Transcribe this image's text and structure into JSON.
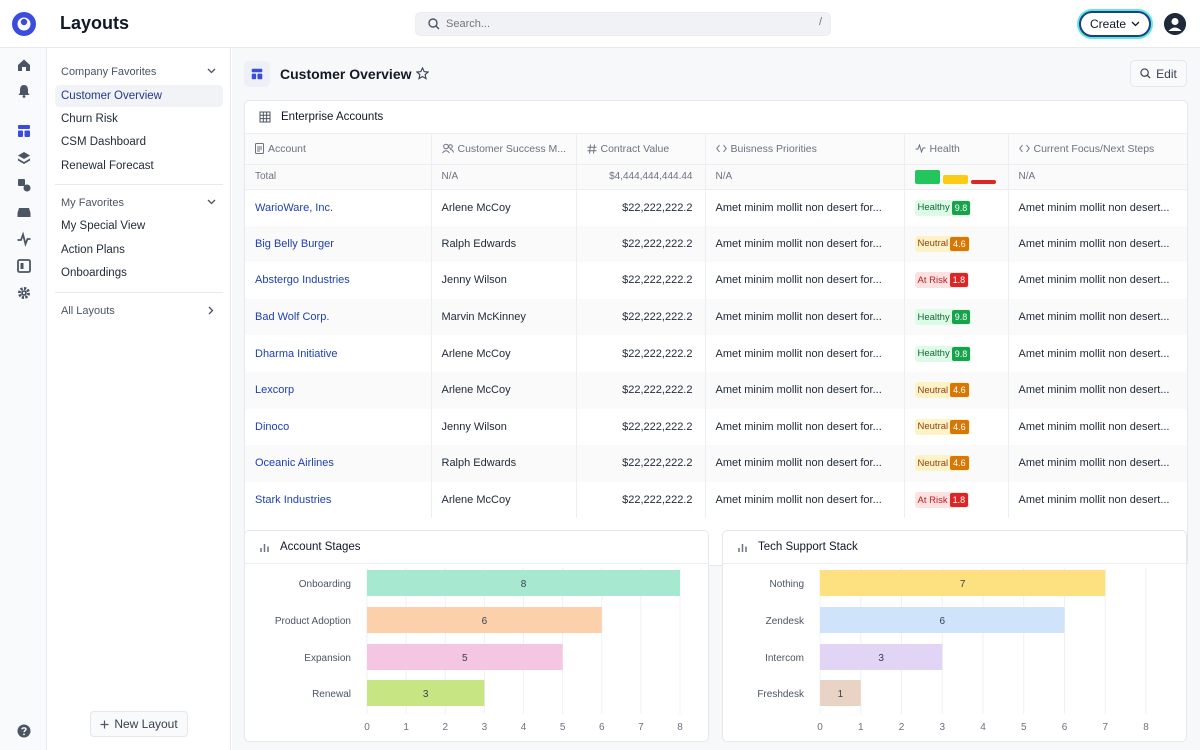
{
  "app_title": "Layouts",
  "search": {
    "placeholder": "Search...",
    "shortcut": "/"
  },
  "create_label": "Create",
  "sidebar": {
    "company_favorites": {
      "title": "Company Favorites",
      "items": [
        "Customer Overview",
        "Churn Risk",
        "CSM Dashboard",
        "Renewal Forecast"
      ],
      "active": "Customer Overview"
    },
    "my_favorites": {
      "title": "My Favorites",
      "items": [
        "My Special View",
        "Action Plans",
        "Onboardings"
      ]
    },
    "all_layouts": "All Layouts",
    "new_layout": "New Layout"
  },
  "rail_icons": [
    "home-icon",
    "bell-icon",
    "layouts-icon",
    "layers-icon",
    "shapes-icon",
    "inbox-icon",
    "activity-icon",
    "panel-icon",
    "gear-icon",
    "help-icon"
  ],
  "page": {
    "title": "Customer Overview",
    "edit_label": "Edit"
  },
  "table_card": {
    "title": "Enterprise Accounts",
    "columns": [
      "Account",
      "Customer Success M...",
      "Contract Value",
      "Buisness Priorities",
      "Health",
      "Current Focus/Next Steps"
    ],
    "total": {
      "label": "Total",
      "csm": "N/A",
      "value": "$4,444,444,444.44",
      "priorities": "N/A",
      "focus": "N/A"
    },
    "rows": [
      {
        "account": "WarioWare, Inc.",
        "csm": "Arlene McCoy",
        "value": "$22,222,222.2",
        "priorities": "Amet minim mollit non desert for...",
        "health": "Healthy",
        "score": "9.8",
        "focus": "Amet minim mollit non desert..."
      },
      {
        "account": "Big Belly Burger",
        "csm": "Ralph Edwards",
        "value": "$22,222,222.2",
        "priorities": "Amet minim mollit non desert for...",
        "health": "Neutral",
        "score": "4.6",
        "focus": "Amet minim mollit non desert..."
      },
      {
        "account": "Abstergo Industries",
        "csm": "Jenny Wilson",
        "value": "$22,222,222.2",
        "priorities": "Amet minim mollit non desert for...",
        "health": "At Risk",
        "score": "1.8",
        "focus": "Amet minim mollit non desert..."
      },
      {
        "account": "Bad Wolf Corp.",
        "csm": "Marvin McKinney",
        "value": "$22,222,222.2",
        "priorities": "Amet minim mollit non desert for...",
        "health": "Healthy",
        "score": "9.8",
        "focus": "Amet minim mollit non desert..."
      },
      {
        "account": "Dharma Initiative",
        "csm": "Arlene McCoy",
        "value": "$22,222,222.2",
        "priorities": "Amet minim mollit non desert for...",
        "health": "Healthy",
        "score": "9.8",
        "focus": "Amet minim mollit non desert..."
      },
      {
        "account": "Lexcorp",
        "csm": "Arlene McCoy",
        "value": "$22,222,222.2",
        "priorities": "Amet minim mollit non desert for...",
        "health": "Neutral",
        "score": "4.6",
        "focus": "Amet minim mollit non desert..."
      },
      {
        "account": "Dinoco",
        "csm": "Jenny Wilson",
        "value": "$22,222,222.2",
        "priorities": "Amet minim mollit non desert for...",
        "health": "Neutral",
        "score": "4.6",
        "focus": "Amet minim mollit non desert..."
      },
      {
        "account": "Oceanic Airlines",
        "csm": "Ralph Edwards",
        "value": "$22,222,222.2",
        "priorities": "Amet minim mollit non desert for...",
        "health": "Neutral",
        "score": "4.6",
        "focus": "Amet minim mollit non desert..."
      },
      {
        "account": "Stark Industries",
        "csm": "Arlene McCoy",
        "value": "$22,222,222.2",
        "priorities": "Amet minim mollit non desert for...",
        "health": "At Risk",
        "score": "1.8",
        "focus": "Amet minim mollit non desert..."
      }
    ]
  },
  "colors": {
    "healthy": "#22c55e",
    "neutral": "#facc15",
    "at_risk": "#dc2626"
  },
  "chart_data": [
    {
      "type": "bar",
      "orientation": "horizontal",
      "title": "Account Stages",
      "categories": [
        "Onboarding",
        "Product Adoption",
        "Expansion",
        "Renewal"
      ],
      "values": [
        8,
        6,
        5,
        3
      ],
      "colors": [
        "#a7e9d0",
        "#fbd0ab",
        "#f5c6e3",
        "#c7e582"
      ],
      "xlim": [
        0,
        8
      ],
      "ticks": [
        0,
        1,
        2,
        3,
        4,
        5,
        6,
        7,
        8
      ],
      "grid": true
    },
    {
      "type": "bar",
      "orientation": "horizontal",
      "title": "Tech Support Stack",
      "categories": [
        "Nothing",
        "Zendesk",
        "Intercom",
        "Freshdesk"
      ],
      "values": [
        7,
        6,
        3,
        1
      ],
      "colors": [
        "#fde080",
        "#cfe3fb",
        "#e1d4f5",
        "#e9d3c4"
      ],
      "xlim": [
        0,
        8
      ],
      "ticks": [
        0,
        1,
        2,
        3,
        4,
        5,
        6,
        7,
        8
      ],
      "grid": true
    }
  ]
}
